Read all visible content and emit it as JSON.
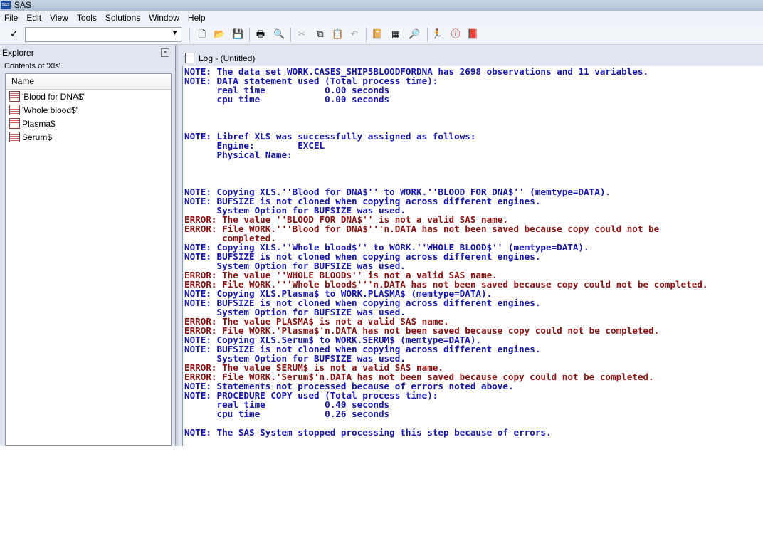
{
  "app": {
    "title": "SAS"
  },
  "menu": [
    "File",
    "Edit",
    "View",
    "Tools",
    "Solutions",
    "Window",
    "Help"
  ],
  "explorer": {
    "title": "Explorer",
    "contents_label": "Contents of 'Xls'",
    "column": "Name",
    "items": [
      "'Blood for DNA$'",
      "'Whole blood$'",
      "Plasma$",
      "Serum$"
    ]
  },
  "log": {
    "title": "Log - (Untitled)",
    "lines": [
      {
        "t": "note",
        "s": "NOTE: The data set WORK.CASES_SHIP5BLOODFORDNA has 2698 observations and 11 variables."
      },
      {
        "t": "note",
        "s": "NOTE: DATA statement used (Total process time):"
      },
      {
        "t": "note",
        "s": "      real time           0.00 seconds"
      },
      {
        "t": "note",
        "s": "      cpu time            0.00 seconds"
      },
      {
        "t": "note",
        "s": ""
      },
      {
        "t": "note",
        "s": ""
      },
      {
        "t": "note",
        "s": ""
      },
      {
        "t": "note",
        "s": "NOTE: Libref XLS was successfully assigned as follows:"
      },
      {
        "t": "note",
        "s": "      Engine:        EXCEL"
      },
      {
        "t": "note",
        "s": "      Physical Name:"
      },
      {
        "t": "note",
        "s": ""
      },
      {
        "t": "note",
        "s": ""
      },
      {
        "t": "note",
        "s": ""
      },
      {
        "t": "note",
        "s": "NOTE: Copying XLS.''Blood for DNA$'' to WORK.''BLOOD FOR DNA$'' (memtype=DATA)."
      },
      {
        "t": "note",
        "s": "NOTE: BUFSIZE is not cloned when copying across different engines."
      },
      {
        "t": "note",
        "s": "      System Option for BUFSIZE was used."
      },
      {
        "t": "error",
        "s": "ERROR: The value ''BLOOD FOR DNA$'' is not a valid SAS name."
      },
      {
        "t": "error",
        "s": "ERROR: File WORK.'''Blood for DNA$'''n.DATA has not been saved because copy could not be"
      },
      {
        "t": "error",
        "s": "       completed."
      },
      {
        "t": "note",
        "s": "NOTE: Copying XLS.''Whole blood$'' to WORK.''WHOLE BLOOD$'' (memtype=DATA)."
      },
      {
        "t": "note",
        "s": "NOTE: BUFSIZE is not cloned when copying across different engines."
      },
      {
        "t": "note",
        "s": "      System Option for BUFSIZE was used."
      },
      {
        "t": "error",
        "s": "ERROR: The value ''WHOLE BLOOD$'' is not a valid SAS name."
      },
      {
        "t": "error",
        "s": "ERROR: File WORK.'''Whole blood$'''n.DATA has not been saved because copy could not be completed."
      },
      {
        "t": "note",
        "s": "NOTE: Copying XLS.Plasma$ to WORK.PLASMA$ (memtype=DATA)."
      },
      {
        "t": "note",
        "s": "NOTE: BUFSIZE is not cloned when copying across different engines."
      },
      {
        "t": "note",
        "s": "      System Option for BUFSIZE was used."
      },
      {
        "t": "error",
        "s": "ERROR: The value PLASMA$ is not a valid SAS name."
      },
      {
        "t": "error",
        "s": "ERROR: File WORK.'Plasma$'n.DATA has not been saved because copy could not be completed."
      },
      {
        "t": "note",
        "s": "NOTE: Copying XLS.Serum$ to WORK.SERUM$ (memtype=DATA)."
      },
      {
        "t": "note",
        "s": "NOTE: BUFSIZE is not cloned when copying across different engines."
      },
      {
        "t": "note",
        "s": "      System Option for BUFSIZE was used."
      },
      {
        "t": "error",
        "s": "ERROR: The value SERUM$ is not a valid SAS name."
      },
      {
        "t": "error",
        "s": "ERROR: File WORK.'Serum$'n.DATA has not been saved because copy could not be completed."
      },
      {
        "t": "note",
        "s": "NOTE: Statements not processed because of errors noted above."
      },
      {
        "t": "note",
        "s": "NOTE: PROCEDURE COPY used (Total process time):"
      },
      {
        "t": "note",
        "s": "      real time           0.40 seconds"
      },
      {
        "t": "note",
        "s": "      cpu time            0.26 seconds"
      },
      {
        "t": "note",
        "s": ""
      },
      {
        "t": "note",
        "s": "NOTE: The SAS System stopped processing this step because of errors."
      }
    ]
  }
}
